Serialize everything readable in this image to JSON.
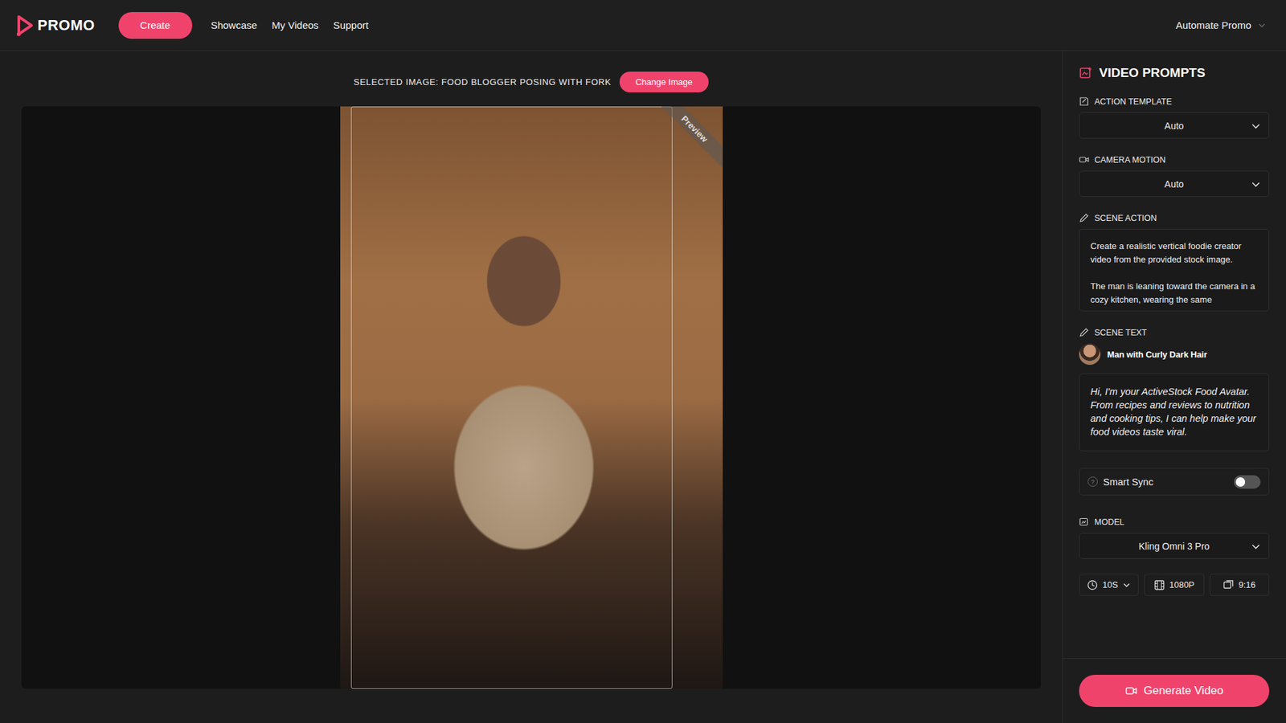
{
  "header": {
    "logo": "PROMO",
    "create": "Create",
    "nav": [
      "Showcase",
      "My Videos",
      "Support"
    ],
    "account": "Automate Promo"
  },
  "selected_image": {
    "label": "SELECTED IMAGE: FOOD BLOGGER POSING WITH FORK",
    "button": "Change Image"
  },
  "preview": {
    "badge": "Preview"
  },
  "panel": {
    "title": "VIDEO PROMPTS",
    "action_template": {
      "label": "ACTION TEMPLATE",
      "value": "Auto"
    },
    "camera_motion": {
      "label": "CAMERA MOTION",
      "value": "Auto"
    },
    "scene_action": {
      "label": "SCENE ACTION",
      "text": "Create a realistic vertical foodie creator video from the provided stock image.\n\nThe man is leaning toward the camera in a cozy kitchen, wearing the same"
    },
    "scene_text": {
      "label": "SCENE TEXT",
      "speaker": "Man with Curly Dark Hair",
      "text": "Hi, I'm your ActiveStock Food Avatar. From recipes and reviews to nutrition and cooking tips, I can help make your food videos taste viral."
    },
    "smart_sync": {
      "label": "Smart Sync",
      "help": "?",
      "on": false
    },
    "model": {
      "label": "MODEL",
      "value": "Kling Omni 3 Pro"
    },
    "options": [
      {
        "kind": "duration",
        "label": "10S",
        "dropdown": true
      },
      {
        "kind": "resolution",
        "label": "1080P",
        "dropdown": false
      },
      {
        "kind": "aspect",
        "label": "9:16",
        "dropdown": false
      }
    ],
    "generate": "Generate Video"
  }
}
